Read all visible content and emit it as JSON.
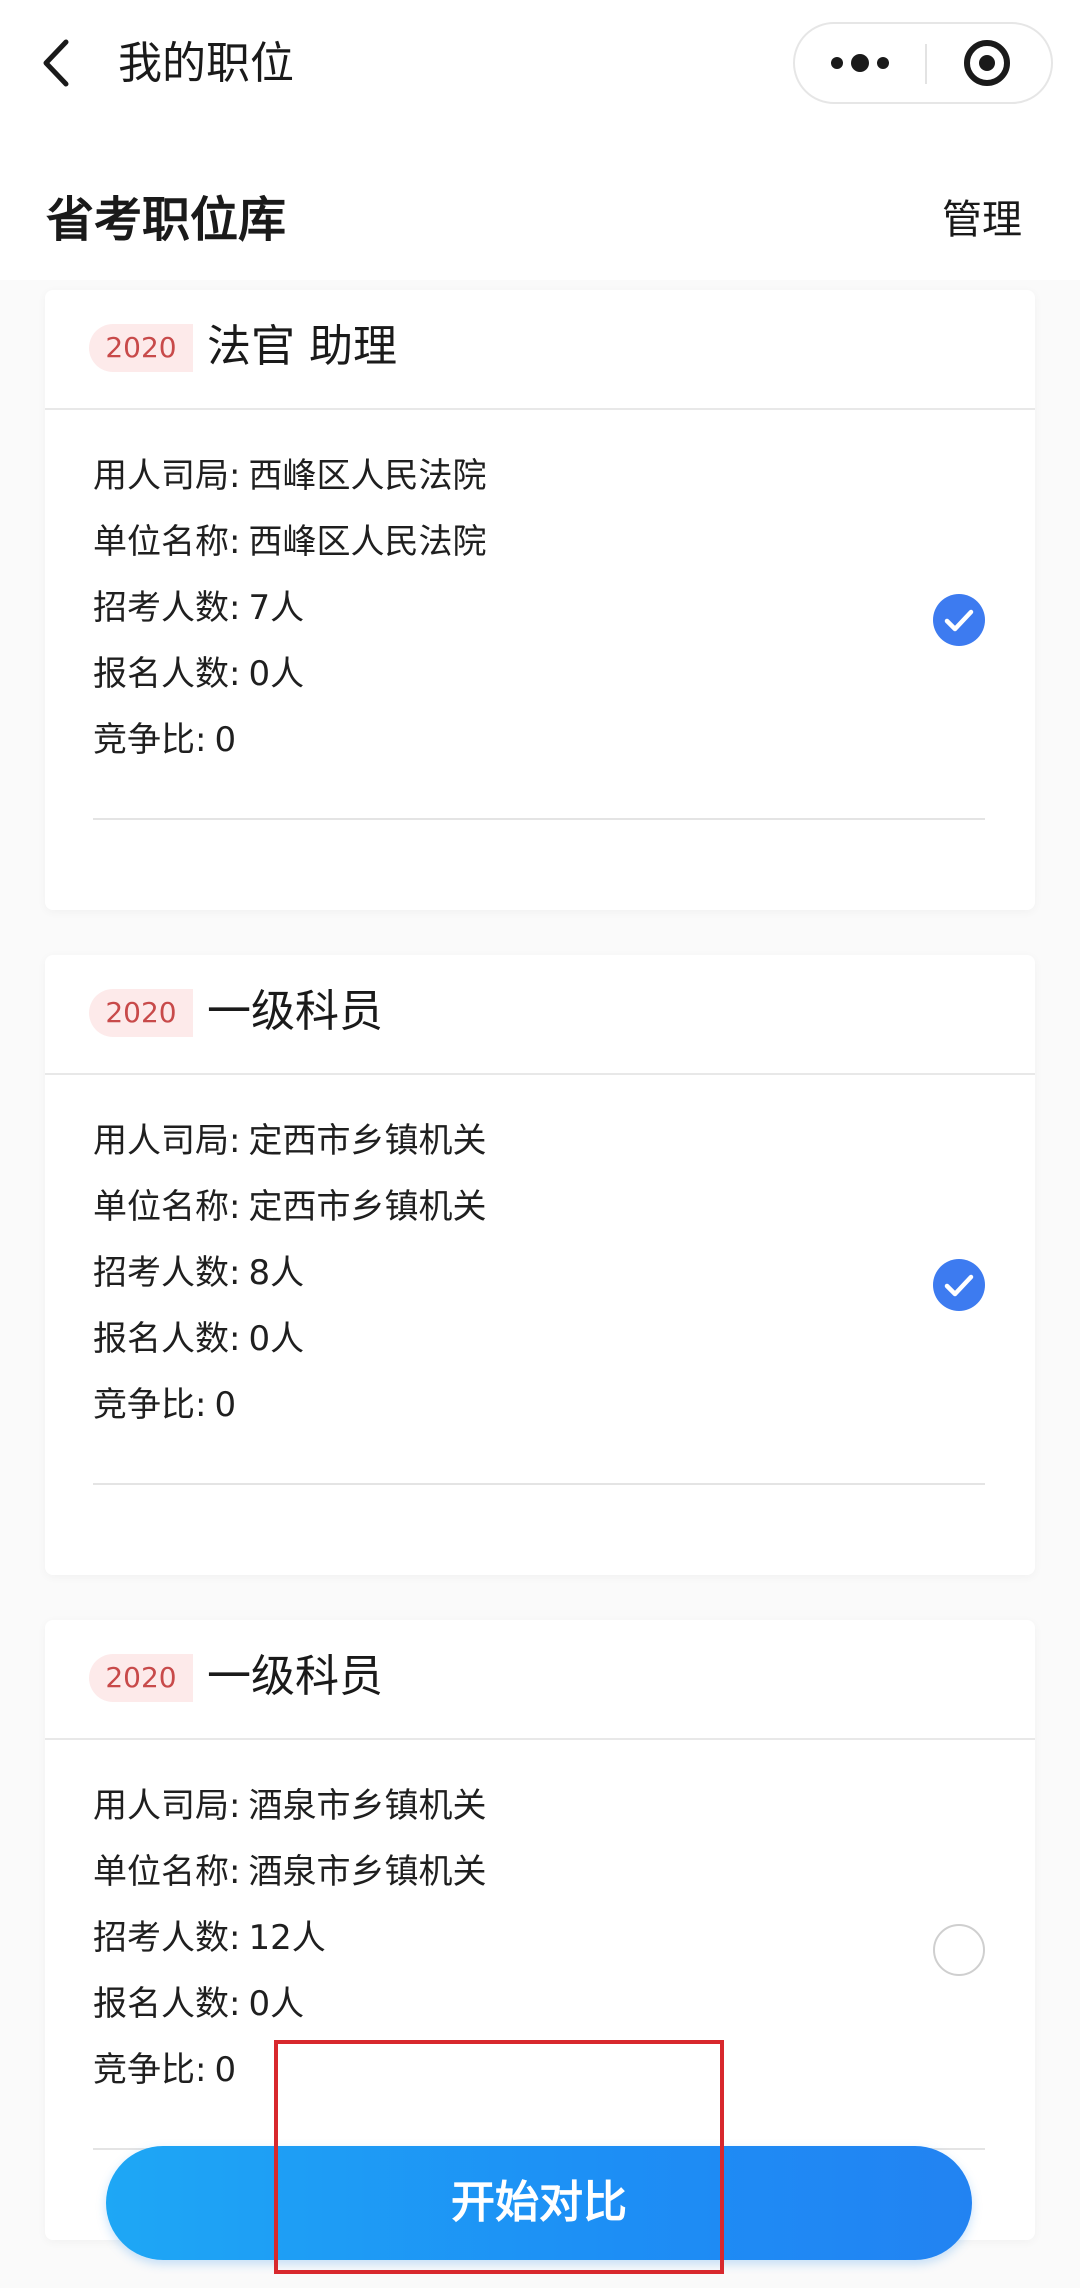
{
  "nav": {
    "title": "我的职位"
  },
  "header": {
    "title": "省考职位库",
    "manage_label": "管理"
  },
  "labels": {
    "agency": "用人司局",
    "unit": "单位名称",
    "recruit": "招考人数",
    "applicants": "报名人数",
    "ratio": "竞争比",
    "separator": ":"
  },
  "jobs": [
    {
      "year": "2020",
      "title": "法官 助理",
      "agency": "西峰区人民法院",
      "unit": "西峰区人民法院",
      "recruit": "7人",
      "applicants": "0人",
      "ratio": "0",
      "selected": true
    },
    {
      "year": "2020",
      "title": "一级科员",
      "agency": "定西市乡镇机关",
      "unit": "定西市乡镇机关",
      "recruit": "8人",
      "applicants": "0人",
      "ratio": "0",
      "selected": true
    },
    {
      "year": "2020",
      "title": "一级科员",
      "agency": "酒泉市乡镇机关",
      "unit": "酒泉市乡镇机关",
      "recruit": "12人",
      "applicants": "0人",
      "ratio": "0",
      "selected": false
    }
  ],
  "actions": {
    "compare_label": "开始对比"
  },
  "icons": {
    "back": "chevron-left-icon",
    "more": "more-dots-icon",
    "close": "target-close-icon",
    "checked": "checkmark-circle-icon",
    "unchecked": "empty-circle-icon"
  },
  "colors": {
    "accent": "#3d7bf0",
    "button_gradient_start": "#1ea7f5",
    "button_gradient_end": "#2283f2",
    "badge_bg": "#fdeaea",
    "badge_text": "#c84a4a",
    "highlight": "#d8282d"
  }
}
